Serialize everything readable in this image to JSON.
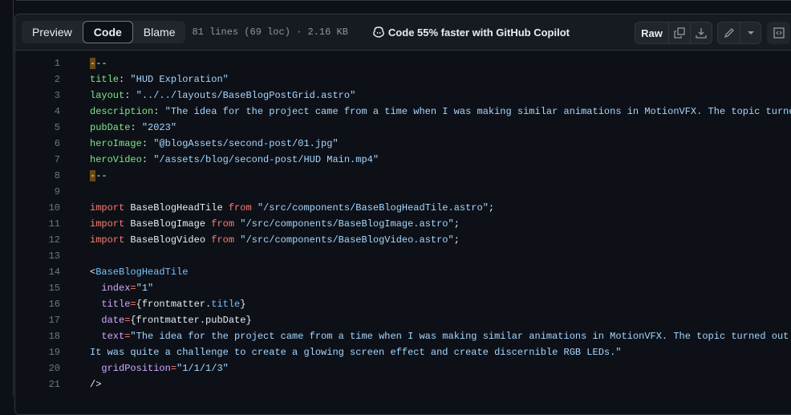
{
  "tabs": [
    {
      "label": "Preview"
    },
    {
      "label": "Code",
      "active": true
    },
    {
      "label": "Blame"
    }
  ],
  "file_meta": "81 lines (69 loc) · 2.16 KB",
  "copilot_text": "Code 55% faster with GitHub Copilot",
  "toolbar": {
    "raw": "Raw",
    "icons": [
      "copy-icon",
      "download-icon",
      "pencil-icon",
      "caret-down-icon",
      "symbols-panel-icon"
    ]
  },
  "lines": [
    [
      [
        "hl",
        "-"
      ],
      [
        "",
        "--"
      ]
    ],
    [
      [
        "g",
        "title"
      ],
      [
        "",
        ": "
      ],
      [
        "s",
        "\"HUD Exploration\""
      ]
    ],
    [
      [
        "g",
        "layout"
      ],
      [
        "",
        ": "
      ],
      [
        "s",
        "\"../../layouts/BaseBlogPostGrid.astro\""
      ]
    ],
    [
      [
        "g",
        "description"
      ],
      [
        "",
        ": "
      ],
      [
        "s",
        "\"The idea for the project came from a time when I was making similar animations in MotionVFX. The topic turned out"
      ]
    ],
    [
      [
        "g",
        "pubDate"
      ],
      [
        "",
        ": "
      ],
      [
        "s",
        "\"2023\""
      ]
    ],
    [
      [
        "g",
        "heroImage"
      ],
      [
        "",
        ": "
      ],
      [
        "s",
        "\"@blogAssets/second-post/01.jpg\""
      ]
    ],
    [
      [
        "g",
        "heroVideo"
      ],
      [
        "",
        ": "
      ],
      [
        "s",
        "\"/assets/blog/second-post/HUD Main.mp4\""
      ]
    ],
    [
      [
        "hl",
        "-"
      ],
      [
        "",
        "--"
      ]
    ],
    [],
    [
      [
        "k",
        "import"
      ],
      [
        "",
        " BaseBlogHeadTile "
      ],
      [
        "k",
        "from"
      ],
      [
        "",
        " "
      ],
      [
        "s",
        "\"/src/components/BaseBlogHeadTile.astro\""
      ],
      [
        "",
        ";"
      ]
    ],
    [
      [
        "k",
        "import"
      ],
      [
        "",
        " BaseBlogImage "
      ],
      [
        "k",
        "from"
      ],
      [
        "",
        " "
      ],
      [
        "s",
        "\"/src/components/BaseBlogImage.astro\""
      ],
      [
        "",
        ";"
      ]
    ],
    [
      [
        "k",
        "import"
      ],
      [
        "",
        " BaseBlogVideo "
      ],
      [
        "k",
        "from"
      ],
      [
        "",
        " "
      ],
      [
        "s",
        "\"/src/components/BaseBlogVideo.astro\""
      ],
      [
        "",
        ";"
      ]
    ],
    [],
    [
      [
        "",
        "<"
      ],
      [
        "b",
        "BaseBlogHeadTile"
      ]
    ],
    [
      [
        "",
        "  "
      ],
      [
        "p",
        "index"
      ],
      [
        "k",
        "="
      ],
      [
        "s",
        "\"1\""
      ]
    ],
    [
      [
        "",
        "  "
      ],
      [
        "p",
        "title"
      ],
      [
        "k",
        "="
      ],
      [
        "",
        "{frontmatter."
      ],
      [
        "b",
        "title"
      ],
      [
        "",
        "}"
      ]
    ],
    [
      [
        "",
        "  "
      ],
      [
        "p",
        "date"
      ],
      [
        "k",
        "="
      ],
      [
        "",
        "{frontmatter.pubDate}"
      ]
    ],
    [
      [
        "",
        "  "
      ],
      [
        "p",
        "text"
      ],
      [
        "k",
        "="
      ],
      [
        "s",
        "\"The idea for the project came from a time when I was making similar animations in MotionVFX. The topic turned out to be"
      ]
    ],
    [
      [
        "s",
        "It was quite a challenge to create a glowing screen effect and create discernible RGB LEDs.\""
      ]
    ],
    [
      [
        "",
        "  "
      ],
      [
        "p",
        "gridPosition"
      ],
      [
        "k",
        "="
      ],
      [
        "s",
        "\"1/1/1/3\""
      ]
    ],
    [
      [
        "",
        "/>"
      ]
    ]
  ]
}
